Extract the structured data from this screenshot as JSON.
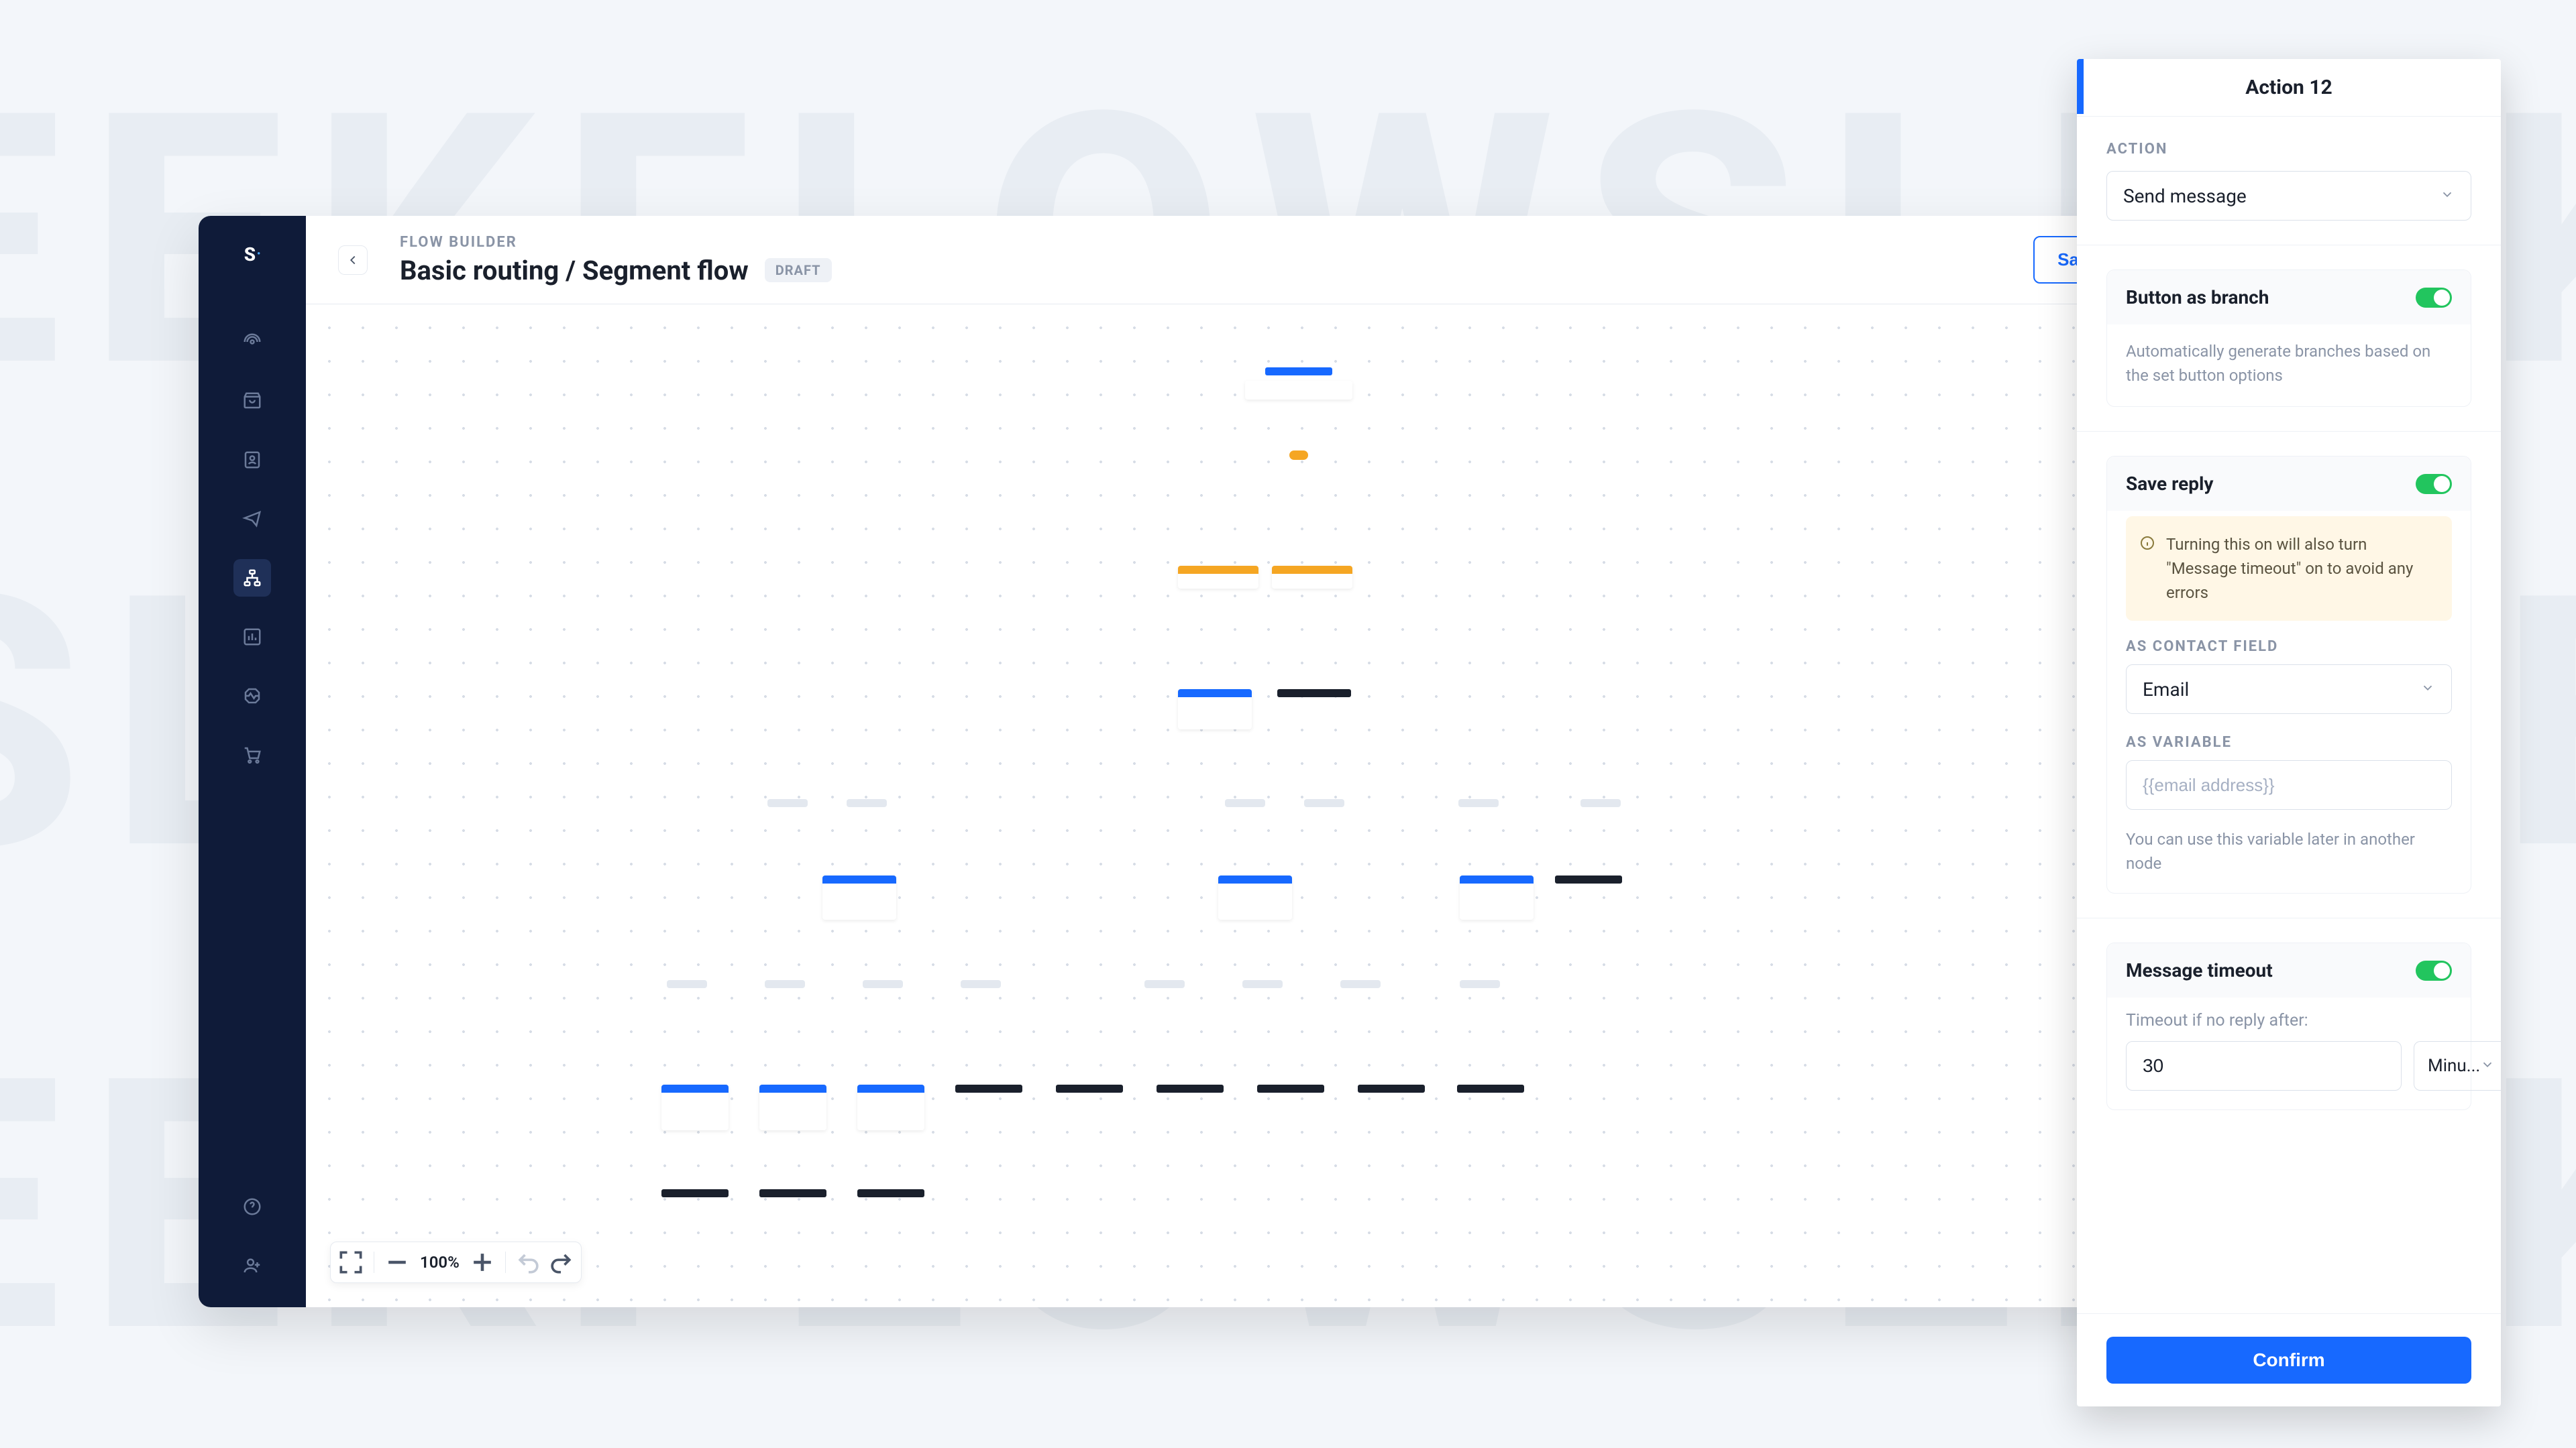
{
  "watermark_rows": [
    "EKFLOWS",
    "SLEEKFLOW",
    "EKFLOWS",
    "SLEEKFLOW"
  ],
  "sidebar": {
    "logo": "S",
    "items": [
      {
        "name": "broadcast-icon"
      },
      {
        "name": "inbox-icon"
      },
      {
        "name": "contact-icon"
      },
      {
        "name": "campaign-icon"
      },
      {
        "name": "flow-icon",
        "active": true
      },
      {
        "name": "analytics-icon"
      },
      {
        "name": "integrations-icon"
      },
      {
        "name": "commerce-icon"
      }
    ],
    "footer": [
      {
        "name": "help-icon"
      },
      {
        "name": "invite-icon"
      }
    ]
  },
  "topbar": {
    "breadcrumb": "FLOW BUILDER",
    "title": "Basic routing / Segment flow",
    "badge": "DRAFT",
    "save_draft": "Save as draft"
  },
  "toolbar": {
    "zoom": "100%"
  },
  "panel": {
    "title": "Action 12",
    "action_label": "ACTION",
    "action_value": "Send message",
    "button_branch": {
      "title": "Button as branch",
      "desc": "Automatically generate branches based on the set button options",
      "on": true
    },
    "save_reply": {
      "title": "Save reply",
      "on": true,
      "info": "Turning this on will also turn \"Message timeout\" on to avoid any errors",
      "contact_field_label": "AS CONTACT FIELD",
      "contact_field_value": "Email",
      "variable_label": "AS VARIABLE",
      "variable_placeholder": "{{email address}}",
      "variable_helper": "You can use this variable later in another node"
    },
    "timeout": {
      "title": "Message timeout",
      "on": true,
      "label": "Timeout if no reply after:",
      "value": "30",
      "unit": "Minu..."
    },
    "confirm": "Confirm"
  }
}
